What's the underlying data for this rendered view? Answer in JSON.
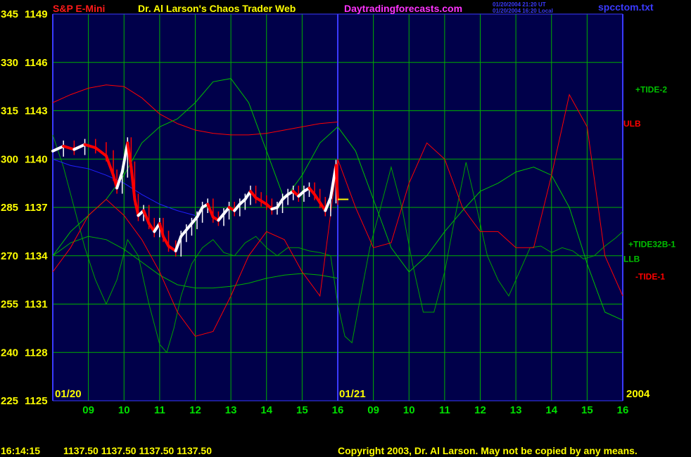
{
  "header": {
    "instrument": "S&P E-Mini",
    "author": "Dr. Al Larson's Chaos Trader Web",
    "website": "Daytradingforecasts.com",
    "time_ut": "01/20/2004 21:20 UT",
    "time_local": "01/20/2004 16:20 Local",
    "file": "spcctom.txt"
  },
  "footer": {
    "time": "16:14:15",
    "quote": "1137.50 1137.50 1137.50 1137.50",
    "copyright": "Copyright 2003, Dr. Al Larson. May not be copied by any means."
  },
  "colors": {
    "plot_bg": "#00004a",
    "grid": "#00b000",
    "divider": "#3a3aff",
    "axis_text": "#ffff00",
    "tick_text": "#00e000",
    "title_instrument": "#ff1a1a",
    "title_author": "#ffff00",
    "title_website": "#ff33ff",
    "timestamp": "#3a3aff",
    "file": "#3a3aff",
    "footer": "#ffff00",
    "price_up": "#ffffff",
    "price_down": "#ff0000",
    "band": "#ff0000",
    "band_low": "#00b000",
    "tide2": "#00c000",
    "tide32b": "#00a000",
    "tide1": "#ff0000",
    "blue_line": "#2020ff",
    "close_marker": "#ffff00"
  },
  "chart_data": {
    "type": "line",
    "title": "S&P E-Mini",
    "y_label": "",
    "x_label": "",
    "y_price_labels": [
      "1149",
      "1146",
      "1143",
      "1140",
      "1137",
      "1134",
      "1131",
      "1128",
      "1125"
    ],
    "y_index_labels": [
      "345",
      "330",
      "315",
      "300",
      "285",
      "270",
      "255",
      "240",
      "225"
    ],
    "y_price_range": [
      1125,
      1149
    ],
    "y_index_range": [
      225,
      345
    ],
    "x_tick_labels": [
      "09",
      "10",
      "11",
      "12",
      "13",
      "14",
      "15",
      "16",
      "09",
      "10",
      "11",
      "12",
      "13",
      "14",
      "15",
      "16"
    ],
    "date_labels": [
      "01/20",
      "01/21"
    ],
    "year_label": "2004",
    "x_range_hours": [
      8.0,
      24.0
    ],
    "x_note": "hours elapsed from 01/20 00:00; 01/21 hours are 24+",
    "series": [
      {
        "name": "S&P E-Mini",
        "kind": "price",
        "x": [
          8.0,
          8.3,
          8.6,
          8.9,
          9.2,
          9.5,
          9.7,
          9.8,
          9.95,
          10.1,
          10.2,
          10.3,
          10.4,
          10.55,
          10.7,
          10.85,
          11.0,
          11.1,
          11.25,
          11.45,
          11.6,
          11.75,
          11.9,
          12.05,
          12.2,
          12.35,
          12.5,
          12.65,
          12.8,
          12.95,
          13.1,
          13.25,
          13.4,
          13.55,
          13.7,
          13.85,
          14.0,
          14.15,
          14.3,
          14.45,
          14.6,
          14.75,
          14.9,
          15.05,
          15.2,
          15.35,
          15.5,
          15.65,
          15.8,
          15.95,
          16.0
        ],
        "values": [
          1140.5,
          1140.8,
          1140.6,
          1140.9,
          1140.7,
          1140.2,
          1139.0,
          1138.2,
          1139.2,
          1141.0,
          1139.5,
          1137.5,
          1136.5,
          1136.8,
          1136.0,
          1135.5,
          1136.0,
          1135.2,
          1134.6,
          1134.3,
          1135.2,
          1135.6,
          1136.0,
          1136.4,
          1137.0,
          1137.2,
          1136.4,
          1136.2,
          1136.6,
          1137.0,
          1136.8,
          1137.2,
          1137.5,
          1138.0,
          1137.6,
          1137.4,
          1137.2,
          1136.9,
          1137.0,
          1137.5,
          1137.8,
          1138.0,
          1137.7,
          1138.0,
          1138.2,
          1137.8,
          1137.3,
          1136.8,
          1137.6,
          1139.6,
          1137.5
        ]
      },
      {
        "name": "ULB",
        "kind": "band",
        "x": [
          8.0,
          8.5,
          9.0,
          9.5,
          10.0,
          10.5,
          11.0,
          11.5,
          12.0,
          12.5,
          13.0,
          13.5,
          14.0,
          14.5,
          15.0,
          15.5,
          16.0
        ],
        "values": [
          1143.5,
          1144.0,
          1144.4,
          1144.6,
          1144.5,
          1143.8,
          1142.8,
          1142.2,
          1141.8,
          1141.6,
          1141.5,
          1141.5,
          1141.6,
          1141.8,
          1142.0,
          1142.2,
          1142.3
        ]
      },
      {
        "name": "LLB",
        "kind": "band",
        "x": [
          8.0,
          8.5,
          9.0,
          9.5,
          10.0,
          10.5,
          11.0,
          11.5,
          12.0,
          12.5,
          13.0,
          13.5,
          14.0,
          14.5,
          15.0,
          15.5,
          16.0
        ],
        "values": [
          1134.0,
          1134.8,
          1135.2,
          1135.0,
          1134.4,
          1133.6,
          1132.8,
          1132.2,
          1132.0,
          1132.0,
          1132.1,
          1132.3,
          1132.6,
          1132.8,
          1132.9,
          1132.8,
          1132.6
        ],
        "color_key": "band_low"
      },
      {
        "name": "+TIDE-2",
        "kind": "tide",
        "x": [
          8.0,
          8.5,
          9.0,
          9.5,
          10.0,
          10.5,
          11.0,
          11.5,
          12.0,
          12.5,
          13.0,
          13.5,
          14.0,
          14.5,
          15.0,
          15.5,
          16.0,
          16.5,
          17.0,
          17.5,
          18.0,
          18.5,
          19.0,
          19.5,
          20.0,
          20.5,
          21.0,
          21.5,
          22.0,
          22.5,
          23.0,
          23.5,
          24.0
        ],
        "values": [
          1134.0,
          1135.5,
          1136.5,
          1137.5,
          1139.0,
          1141.0,
          1142.0,
          1142.5,
          1143.5,
          1144.8,
          1145.0,
          1143.5,
          1140.5,
          1137.5,
          1139.0,
          1141.0,
          1142.0,
          1140.5,
          1137.5,
          1134.5,
          1133.0,
          1134.0,
          1135.5,
          1136.8,
          1138.0,
          1138.5,
          1139.2,
          1139.5,
          1139.0,
          1137.0,
          1133.5,
          1130.5,
          1130.0
        ]
      },
      {
        "name": "+TIDE32B-1",
        "kind": "tide",
        "x": [
          8.0,
          8.3,
          8.6,
          8.9,
          9.2,
          9.5,
          9.8,
          10.1,
          10.4,
          10.7,
          11.0,
          11.2,
          11.4,
          11.6,
          11.9,
          12.2,
          12.5,
          12.8,
          13.1,
          13.4,
          13.7,
          14.0,
          14.3,
          14.6,
          14.9,
          15.2,
          15.5,
          15.8,
          16.0,
          16.2,
          16.4,
          16.6,
          16.9,
          17.2,
          17.5,
          17.8,
          18.1,
          18.4,
          18.7,
          19.0,
          19.3,
          19.6,
          19.9,
          20.2,
          20.5,
          20.8,
          21.1,
          21.4,
          21.7,
          22.0,
          22.3,
          22.6,
          22.9,
          23.2,
          23.5,
          23.8,
          24.0
        ],
        "values": [
          1141.5,
          1139.5,
          1137.0,
          1134.5,
          1132.5,
          1131.0,
          1132.5,
          1135.0,
          1134.0,
          1131.0,
          1128.5,
          1128.0,
          1129.5,
          1131.5,
          1133.5,
          1134.5,
          1135.0,
          1134.2,
          1134.0,
          1134.8,
          1135.2,
          1134.5,
          1134.0,
          1134.5,
          1134.5,
          1134.3,
          1134.2,
          1134.0,
          1131.0,
          1129.0,
          1128.6,
          1131.0,
          1134.5,
          1137.0,
          1139.5,
          1137.0,
          1133.5,
          1130.5,
          1130.5,
          1133.0,
          1136.5,
          1139.8,
          1137.0,
          1134.0,
          1132.5,
          1131.5,
          1133.0,
          1134.5,
          1134.6,
          1134.2,
          1134.5,
          1134.3,
          1133.8,
          1134.0,
          1134.6,
          1135.1,
          1135.5
        ],
        "color_key": "tide32b"
      },
      {
        "name": "-TIDE-1",
        "kind": "tide",
        "x": [
          8.0,
          8.5,
          9.0,
          9.5,
          10.0,
          10.5,
          11.0,
          11.5,
          12.0,
          12.5,
          13.0,
          13.5,
          14.0,
          14.5,
          15.0,
          15.5,
          16.0,
          16.5,
          17.0,
          17.5,
          18.0,
          18.5,
          19.0,
          19.5,
          20.0,
          20.5,
          21.0,
          21.5,
          22.0,
          22.5,
          23.0,
          23.5,
          24.0
        ],
        "values": [
          1133.0,
          1134.5,
          1136.5,
          1137.5,
          1136.5,
          1135.0,
          1133.0,
          1130.5,
          1129.0,
          1129.3,
          1131.5,
          1134.0,
          1135.5,
          1135.0,
          1133.0,
          1131.5,
          1140.0,
          1137.0,
          1134.5,
          1134.8,
          1138.5,
          1141.0,
          1140.0,
          1137.0,
          1135.5,
          1135.5,
          1134.5,
          1134.5,
          1139.0,
          1144.0,
          1142.0,
          1134.0,
          1131.5
        ]
      },
      {
        "name": "",
        "kind": "avg",
        "x": [
          8.0,
          8.5,
          9.0,
          9.5,
          10.0,
          10.5,
          11.0,
          11.5,
          12.0
        ],
        "values": [
          1140.0,
          1139.6,
          1139.4,
          1139.0,
          1138.5,
          1137.8,
          1137.2,
          1136.8,
          1136.5
        ],
        "color_key": "blue_line"
      }
    ],
    "legend_labels": [
      "+TIDE-2",
      "ULB",
      "+TIDE32B-1",
      "LLB",
      "-TIDE-1"
    ],
    "close_marker": {
      "x": [
        16.0,
        16.3
      ],
      "y": 1137.5
    },
    "day_divider_x": 16.0,
    "grid": true
  }
}
